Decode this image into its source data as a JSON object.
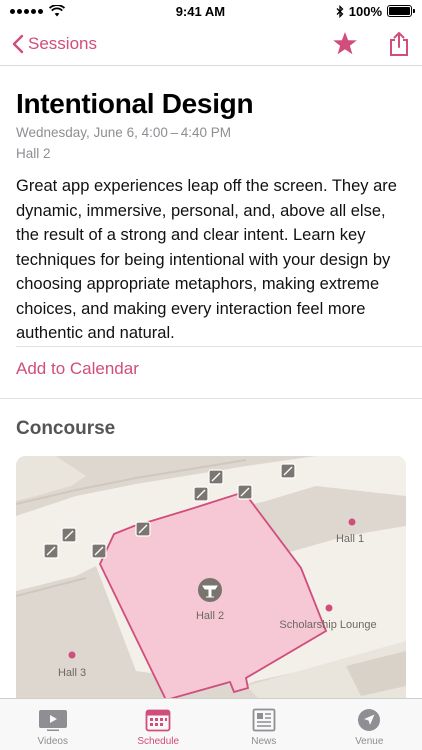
{
  "status": {
    "time": "9:41 AM",
    "battery": "100%"
  },
  "nav": {
    "back_label": "Sessions"
  },
  "session": {
    "title": "Intentional Design",
    "date": "Wednesday, June 6, 4:00 – 4:40 PM",
    "room": "Hall 2",
    "description": "Great app experiences leap off the screen. They are dynamic, immersive, personal, and, above all else, the result of a strong and clear intent. Learn key techniques for being intentional with your design by choosing appropriate metaphors, making extreme choices, and making every interaction feel more authentic and natural.",
    "add_to_calendar": "Add to Calendar"
  },
  "map": {
    "section_title": "Concourse",
    "labels": {
      "hall2": "Hall 2",
      "hall1": "Hall 1",
      "hall3": "Hall 3",
      "lounge": "Scholarship Lounge"
    }
  },
  "tabs": [
    {
      "label": "Videos",
      "icon": "video-icon",
      "active": false
    },
    {
      "label": "Schedule",
      "icon": "calendar-icon",
      "active": true
    },
    {
      "label": "News",
      "icon": "newspaper-icon",
      "active": false
    },
    {
      "label": "Venue",
      "icon": "location-arrow-icon",
      "active": false
    }
  ],
  "colors": {
    "accent": "#d04d7c",
    "highlight_fill": "#f6c7d4"
  }
}
